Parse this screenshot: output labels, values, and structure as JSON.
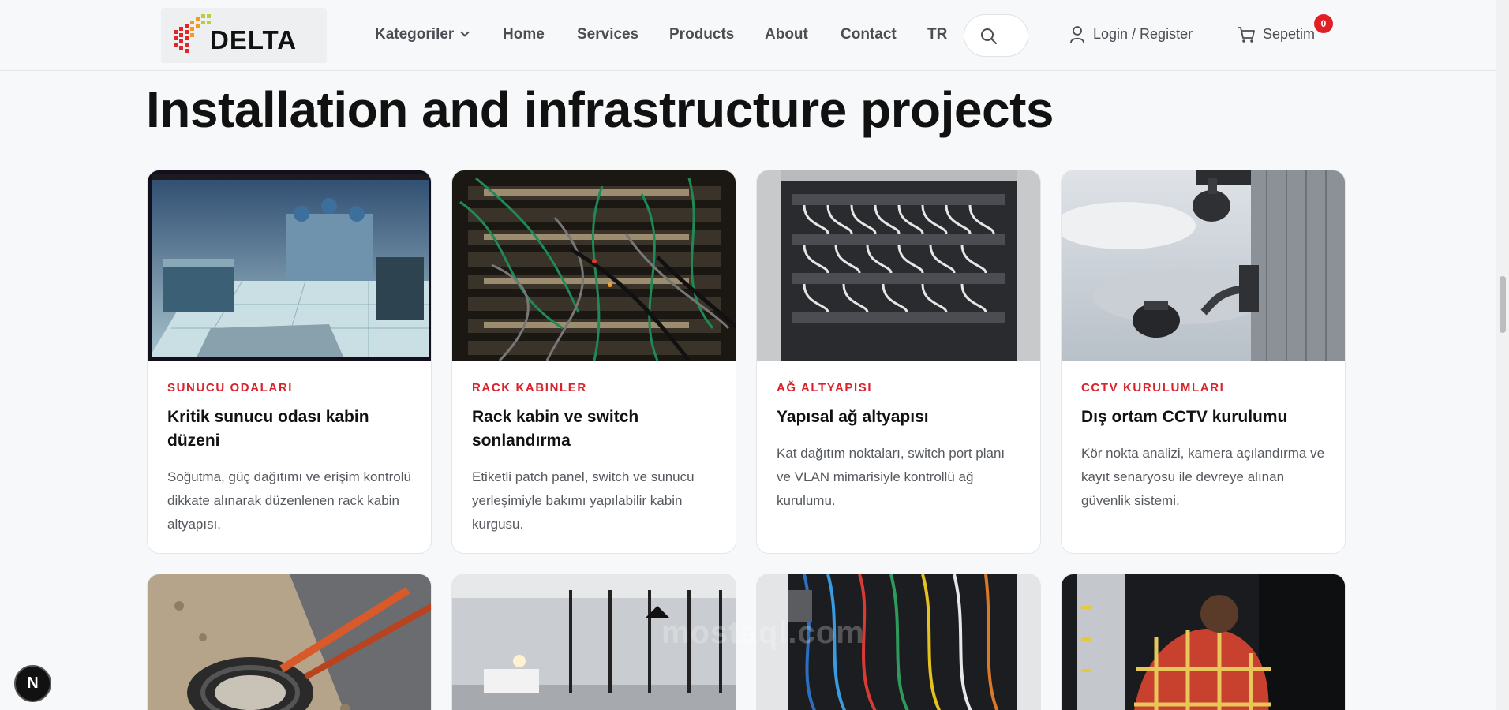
{
  "nav": {
    "logo_text": "DELTA",
    "items": [
      {
        "label": "Kategoriler"
      },
      {
        "label": "Home"
      },
      {
        "label": "Services"
      },
      {
        "label": "Products"
      },
      {
        "label": "About"
      },
      {
        "label": "Contact"
      },
      {
        "label": "TR"
      }
    ],
    "search_icon": "search-icon",
    "login_label": "Login / Register",
    "cart_label": "Sepetim",
    "cart_count": "0"
  },
  "section": {
    "title": "Installation and infrastructure projects"
  },
  "cards": [
    {
      "category": "SUNUCU ODALARI",
      "title": "Kritik sunucu odası kabin düzeni",
      "description": "Soğutma, güç dağıtımı ve erişim kontrolü dikkate alınarak düzenlenen rack kabin altyapısı."
    },
    {
      "category": "RACK KABINLER",
      "title": "Rack kabin ve switch sonlandırma",
      "description": "Etiketli patch panel, switch ve sunucu yerleşimiyle bakımı yapılabilir kabin kurgusu."
    },
    {
      "category": "AĞ ALTYAPISI",
      "title": "Yapısal ağ altyapısı",
      "description": "Kat dağıtım noktaları, switch port planı ve VLAN mimarisiyle kontrollü ağ kurulumu."
    },
    {
      "category": "CCTV KURULUMLARI",
      "title": "Dış ortam CCTV kurulumu",
      "description": "Kör nokta analizi, kamera açılandırma ve kayıt senaryosu ile devreye alınan güvenlik sistemi."
    }
  ],
  "floating_button": "N",
  "watermark": "mostaql.com",
  "colors": {
    "accent": "#d9232d",
    "badge": "#e01f26",
    "background": "#f7f8f9"
  }
}
